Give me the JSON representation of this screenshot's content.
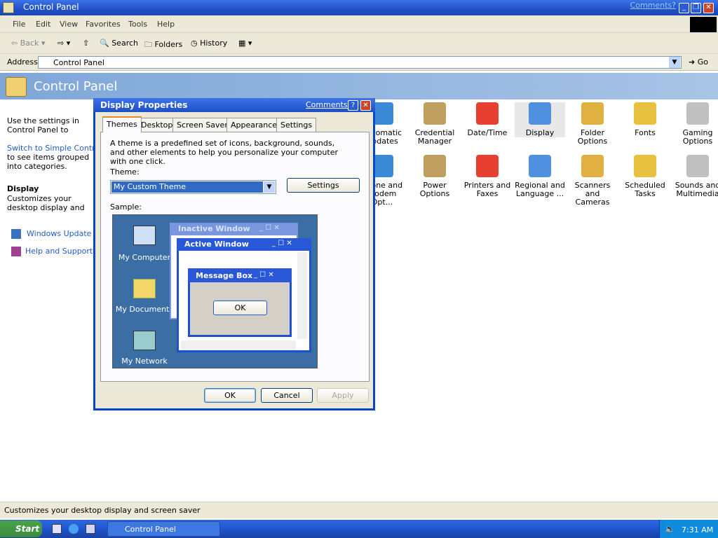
{
  "window": {
    "title": "Control Panel",
    "comments": "Comments?"
  },
  "menu": [
    "File",
    "Edit",
    "View",
    "Favorites",
    "Tools",
    "Help"
  ],
  "toolbar": {
    "back": "Back",
    "search": "Search",
    "folders": "Folders",
    "history": "History"
  },
  "address": {
    "label": "Address",
    "value": "Control Panel",
    "go": "Go"
  },
  "header": {
    "title": "Control Panel"
  },
  "left_pane": {
    "intro": "Use the settings in Control Panel to personalize your computer.",
    "switch_link": "Switch to Simple Control Panel",
    "switch_rest": "to see items grouped into categories.",
    "section_title": "Display",
    "section_desc": "Customizes your desktop display and screen saver",
    "links": [
      "Windows Update",
      "Help and Support"
    ]
  },
  "icons": [
    {
      "label": "Automatic Updates",
      "row": 0,
      "col": 0
    },
    {
      "label": "Credential Manager",
      "row": 0,
      "col": 1
    },
    {
      "label": "Date/Time",
      "row": 0,
      "col": 2
    },
    {
      "label": "Display",
      "row": 0,
      "col": 3
    },
    {
      "label": "Folder Options",
      "row": 0,
      "col": 4
    },
    {
      "label": "Fonts",
      "row": 0,
      "col": 5
    },
    {
      "label": "Gaming Options",
      "row": 0,
      "col": 6
    },
    {
      "label": "Phone and Modem Opt...",
      "row": 1,
      "col": 0
    },
    {
      "label": "Power Options",
      "row": 1,
      "col": 1
    },
    {
      "label": "Printers and Faxes",
      "row": 1,
      "col": 2
    },
    {
      "label": "Regional and Language ...",
      "row": 1,
      "col": 3
    },
    {
      "label": "Scanners and Cameras",
      "row": 1,
      "col": 4
    },
    {
      "label": "Scheduled Tasks",
      "row": 1,
      "col": 5
    },
    {
      "label": "Sounds and Multimedia",
      "row": 1,
      "col": 6
    }
  ],
  "dialog": {
    "title": "Display Properties",
    "comments": "Comments?",
    "tabs": [
      "Themes",
      "Desktop",
      "Screen Saver",
      "Appearance",
      "Settings"
    ],
    "description": "A theme is a predefined set of icons, background, sounds, and other elements to help you personalize your computer with one click.",
    "theme_label": "Theme:",
    "theme_value": "My Custom Theme",
    "settings_button": "Settings",
    "sample_label": "Sample:",
    "sample": {
      "desktop_icons": [
        "My Computer",
        "My Documents",
        "My Network Places"
      ],
      "inactive_title": "Inactive Window",
      "active_title": "Active Window",
      "msgbox_title": "Message Box",
      "msgbox_ok": "OK"
    },
    "ok": "OK",
    "cancel": "Cancel",
    "apply": "Apply"
  },
  "statusbar": "Customizes your desktop display and screen saver",
  "taskbar": {
    "start": "Start",
    "task": "Control Panel",
    "clock": "7:31 AM"
  }
}
